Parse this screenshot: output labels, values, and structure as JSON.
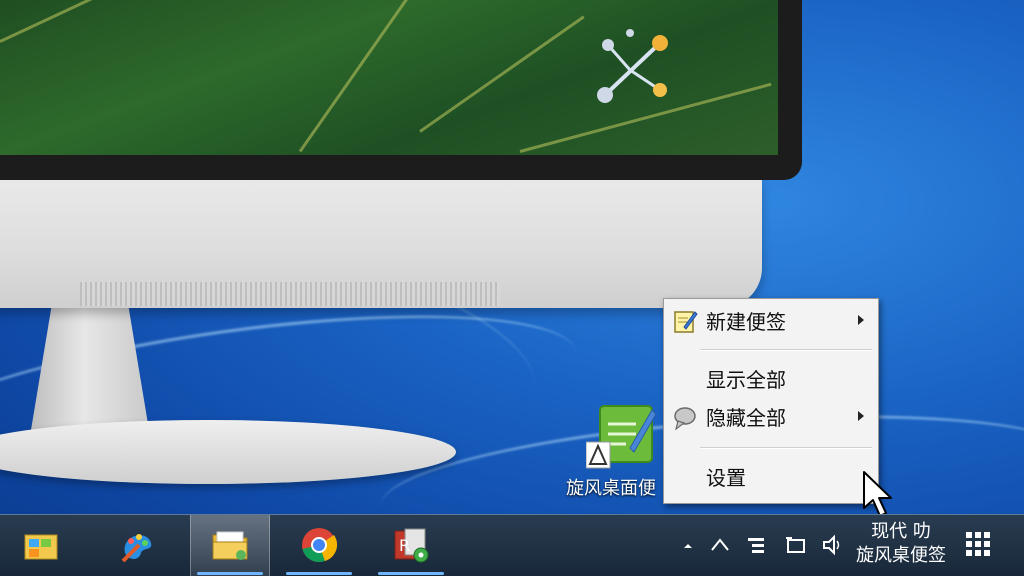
{
  "desktop": {
    "shortcut_label": "旋风桌面便"
  },
  "context_menu": {
    "items": [
      {
        "label": "新建便签",
        "has_submenu": true,
        "icon": "notepad-pencil-icon"
      },
      {
        "label": "显示全部",
        "has_submenu": false,
        "icon": ""
      },
      {
        "label": "隐藏全部",
        "has_submenu": true,
        "icon": "speech-bubble-icon"
      },
      {
        "label": "设置",
        "has_submenu": false,
        "icon": ""
      }
    ]
  },
  "taskbar": {
    "pinned": [
      {
        "icon": "start-folder-icon"
      },
      {
        "icon": "paint-palette-icon"
      },
      {
        "icon": "file-explorer-icon",
        "active": true
      },
      {
        "icon": "chrome-icon"
      },
      {
        "icon": "toolbox-app-icon"
      }
    ],
    "tray_icons": [
      "show-hidden-icons-arrow",
      "tray-chevron-up-icon",
      "action-center-icon",
      "network-icon",
      "volume-icon"
    ],
    "clock_line1": "现代 叻",
    "clock_line2": "旋风桌便签",
    "grid_icon": "app-grid-icon"
  },
  "colors": {
    "taskbar": "#1e3044",
    "menu_bg": "#f3f3f3",
    "desktop_blue": "#1a63c4"
  }
}
